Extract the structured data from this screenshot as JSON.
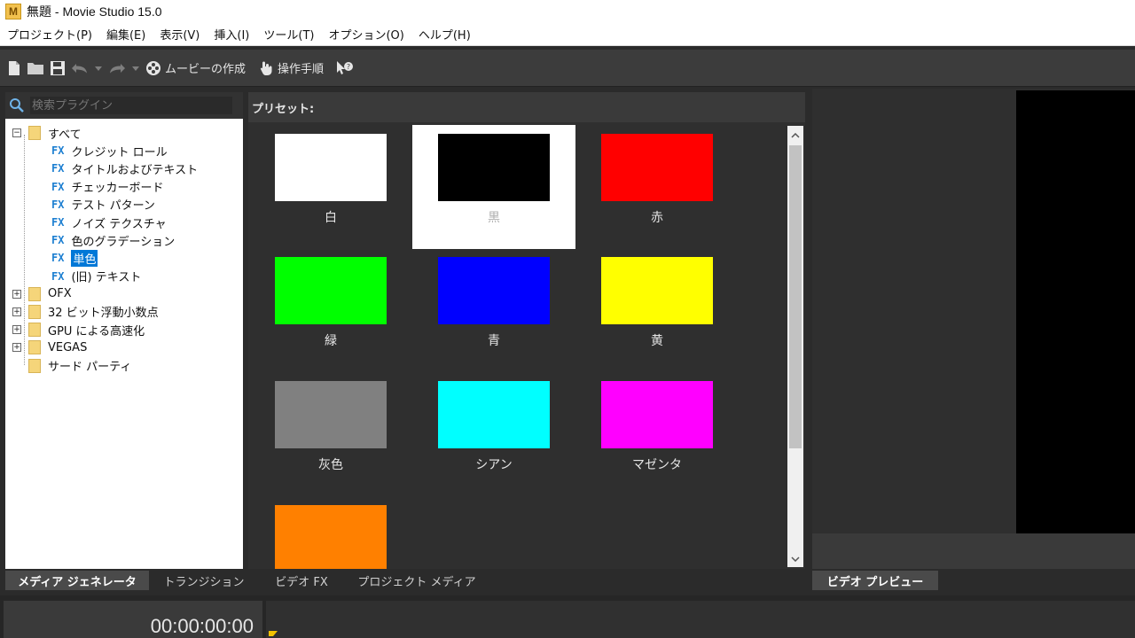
{
  "window": {
    "title": "無題 - Movie Studio 15.0",
    "app_icon_letter": "M"
  },
  "menu": [
    "プロジェクト(P)",
    "編集(E)",
    "表示(V)",
    "挿入(I)",
    "ツール(T)",
    "オプション(O)",
    "ヘルプ(H)"
  ],
  "toolbar": {
    "make_movie_label": "ムービーの作成",
    "guide_label": "操作手順"
  },
  "search": {
    "placeholder": "検索プラグイン"
  },
  "tree": {
    "root": "すべて",
    "children": [
      "クレジット ロール",
      "タイトルおよびテキスト",
      "チェッカーボード",
      "テスト パターン",
      "ノイズ テクスチャ",
      "色のグラデーション",
      "単色",
      "(旧) テキスト"
    ],
    "fx_badge": "FX",
    "selected": "単色",
    "folders": [
      "OFX",
      "32 ビット浮動小数点",
      "GPU による高速化",
      "VEGAS",
      "サード パーティ"
    ]
  },
  "presets": {
    "header": "プリセット:",
    "items": [
      {
        "label": "白",
        "color": "#ffffff"
      },
      {
        "label": "黒",
        "color": "#000000",
        "selected": true
      },
      {
        "label": "赤",
        "color": "#ff0000"
      },
      {
        "label": "緑",
        "color": "#00ff00"
      },
      {
        "label": "青",
        "color": "#0000ff"
      },
      {
        "label": "黄",
        "color": "#ffff00"
      },
      {
        "label": "灰色",
        "color": "#808080"
      },
      {
        "label": "シアン",
        "color": "#00ffff"
      },
      {
        "label": "マゼンタ",
        "color": "#ff00ff"
      },
      {
        "label": "",
        "color": "#ff8000"
      }
    ]
  },
  "tabs": [
    "メディア ジェネレータ",
    "トランジション",
    "ビデオ FX",
    "プロジェクト メディア"
  ],
  "preview_tab": "ビデオ プレビュー",
  "timecode": "00:00:00:00",
  "colors": {
    "selection": "#0078d7",
    "fx_badge": "#1d7fd1"
  }
}
